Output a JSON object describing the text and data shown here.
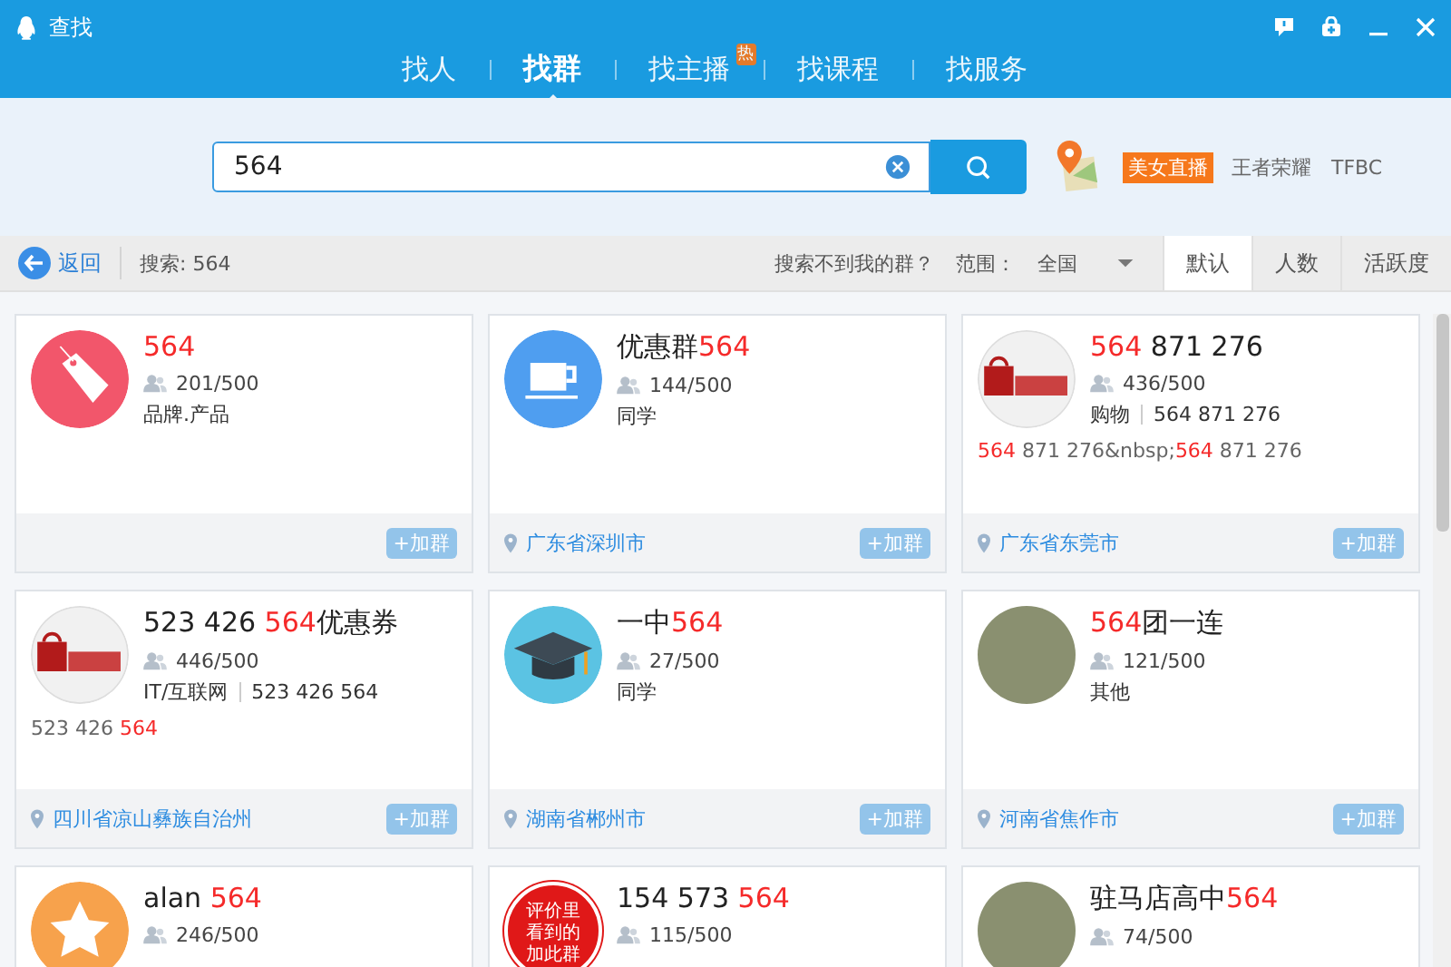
{
  "window": {
    "title": "查找"
  },
  "tabs": [
    {
      "label": "找人",
      "selected": false
    },
    {
      "label": "找群",
      "selected": true
    },
    {
      "label": "找主播",
      "selected": false,
      "badge": "热"
    },
    {
      "label": "找课程",
      "selected": false
    },
    {
      "label": "找服务",
      "selected": false
    }
  ],
  "search": {
    "value": "564"
  },
  "hot_links": [
    {
      "label": "美女直播",
      "kind": "badge"
    },
    {
      "label": "王者荣耀",
      "kind": "link"
    },
    {
      "label": "TFBC",
      "kind": "link"
    }
  ],
  "toolbar": {
    "back": "返回",
    "query": "搜索: 564",
    "not_found": "搜索不到我的群？",
    "scope_label": "范围：",
    "scope": "全国",
    "sorts": [
      {
        "label": "默认",
        "selected": true
      },
      {
        "label": "人数",
        "selected": false
      },
      {
        "label": "活跃度",
        "selected": false
      }
    ]
  },
  "groups": [
    {
      "avatar": {
        "kind": "tag"
      },
      "title": [
        {
          "text": "564",
          "highlight": true
        }
      ],
      "members": "201/500",
      "category": "品牌.产品",
      "join": "+加群"
    },
    {
      "avatar": {
        "kind": "cup"
      },
      "title": [
        {
          "text": "优惠群",
          "highlight": false
        },
        {
          "text": "564",
          "highlight": true
        }
      ],
      "members": "144/500",
      "category": "同学",
      "location": "广东省深圳市",
      "join": "+加群"
    },
    {
      "avatar": {
        "kind": "shop"
      },
      "title": [
        {
          "text": "564",
          "highlight": true
        },
        {
          "text": " 871 276",
          "highlight": false
        }
      ],
      "members": "436/500",
      "category": "购物",
      "extra": "564 871 276",
      "desc": [
        {
          "text": "564",
          "highlight": true
        },
        {
          "text": " 871 276&nbsp;",
          "highlight": false
        },
        {
          "text": "564",
          "highlight": true
        },
        {
          "text": " 871 276",
          "highlight": false
        }
      ],
      "location": "广东省东莞市",
      "join": "+加群"
    },
    {
      "avatar": {
        "kind": "shop"
      },
      "title": [
        {
          "text": "523 426 ",
          "highlight": false
        },
        {
          "text": "564",
          "highlight": true
        },
        {
          "text": "优惠券",
          "highlight": false
        }
      ],
      "members": "446/500",
      "category": "IT/互联网",
      "extra": "523 426 564",
      "desc": [
        {
          "text": "523 426 ",
          "highlight": false
        },
        {
          "text": "564",
          "highlight": true
        }
      ],
      "location": "四川省凉山彝族自治州",
      "join": "+加群"
    },
    {
      "avatar": {
        "kind": "cap"
      },
      "title": [
        {
          "text": "一中",
          "highlight": false
        },
        {
          "text": "564",
          "highlight": true
        }
      ],
      "members": "27/500",
      "category": "同学",
      "location": "湖南省郴州市",
      "join": "+加群"
    },
    {
      "avatar": {
        "kind": "photo"
      },
      "title": [
        {
          "text": "564",
          "highlight": true
        },
        {
          "text": "团一连",
          "highlight": false
        }
      ],
      "members": "121/500",
      "category": "其他",
      "location": "河南省焦作市",
      "join": "+加群"
    },
    {
      "avatar": {
        "kind": "star"
      },
      "title": [
        {
          "text": "alan ",
          "highlight": false
        },
        {
          "text": "564",
          "highlight": true
        }
      ],
      "members": "246/500"
    },
    {
      "avatar": {
        "kind": "seal",
        "text": "评价里看到的加此群"
      },
      "title": [
        {
          "text": "154 573 ",
          "highlight": false
        },
        {
          "text": "564",
          "highlight": true
        }
      ],
      "members": "115/500"
    },
    {
      "avatar": {
        "kind": "photo"
      },
      "title": [
        {
          "text": "驻马店高中",
          "highlight": false
        },
        {
          "text": "564",
          "highlight": true
        }
      ],
      "members": "74/500"
    }
  ]
}
